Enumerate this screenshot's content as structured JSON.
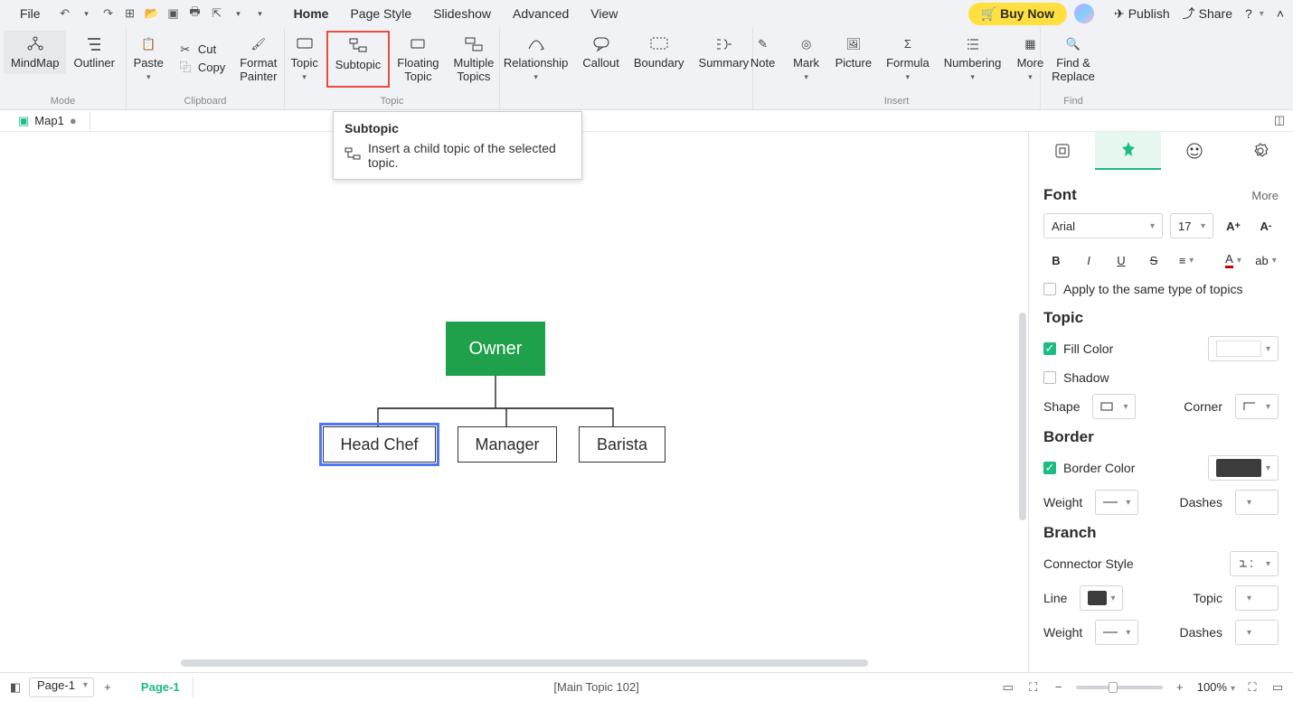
{
  "menubar": {
    "file": "File",
    "tabs": [
      "Home",
      "Page Style",
      "Slideshow",
      "Advanced",
      "View"
    ],
    "active_tab": "Home",
    "buy_now": "Buy Now",
    "publish": "Publish",
    "share": "Share"
  },
  "ribbon": {
    "mode": {
      "mindmap": "MindMap",
      "outliner": "Outliner",
      "label": "Mode"
    },
    "clipboard": {
      "paste": "Paste",
      "cut": "Cut",
      "copy": "Copy",
      "format_painter": "Format\nPainter",
      "label": "Clipboard"
    },
    "topic": {
      "topic": "Topic",
      "subtopic": "Subtopic",
      "floating": "Floating\nTopic",
      "multiple": "Multiple\nTopics",
      "label": "Topic"
    },
    "structure": {
      "relationship": "Relationship",
      "callout": "Callout",
      "boundary": "Boundary",
      "summary": "Summary"
    },
    "insert": {
      "note": "Note",
      "mark": "Mark",
      "picture": "Picture",
      "formula": "Formula",
      "numbering": "Numbering",
      "more": "More",
      "label": "Insert"
    },
    "find": {
      "find_replace": "Find &\nReplace",
      "label": "Find"
    }
  },
  "tooltip": {
    "title": "Subtopic",
    "desc": "Insert a child topic of the selected topic."
  },
  "doc_tab": {
    "name": "Map1"
  },
  "canvas": {
    "root": "Owner",
    "children": [
      "Head Chef",
      "Manager",
      "Barista"
    ],
    "selected": "Head Chef"
  },
  "panel": {
    "font": {
      "title": "Font",
      "more": "More",
      "family": "Arial",
      "size": "17",
      "apply_same": "Apply to the same type of topics"
    },
    "topic": {
      "title": "Topic",
      "fill_color": "Fill Color",
      "shadow": "Shadow",
      "shape": "Shape",
      "corner": "Corner"
    },
    "border": {
      "title": "Border",
      "border_color": "Border Color",
      "weight": "Weight",
      "dashes": "Dashes",
      "color": "#3c3c3c"
    },
    "branch": {
      "title": "Branch",
      "connector_style": "Connector Style",
      "line": "Line",
      "topic": "Topic",
      "weight": "Weight",
      "dashes": "Dashes"
    }
  },
  "status": {
    "page_select": "Page-1",
    "page_tab": "Page-1",
    "selection": "[Main Topic 102]",
    "zoom": "100%"
  }
}
